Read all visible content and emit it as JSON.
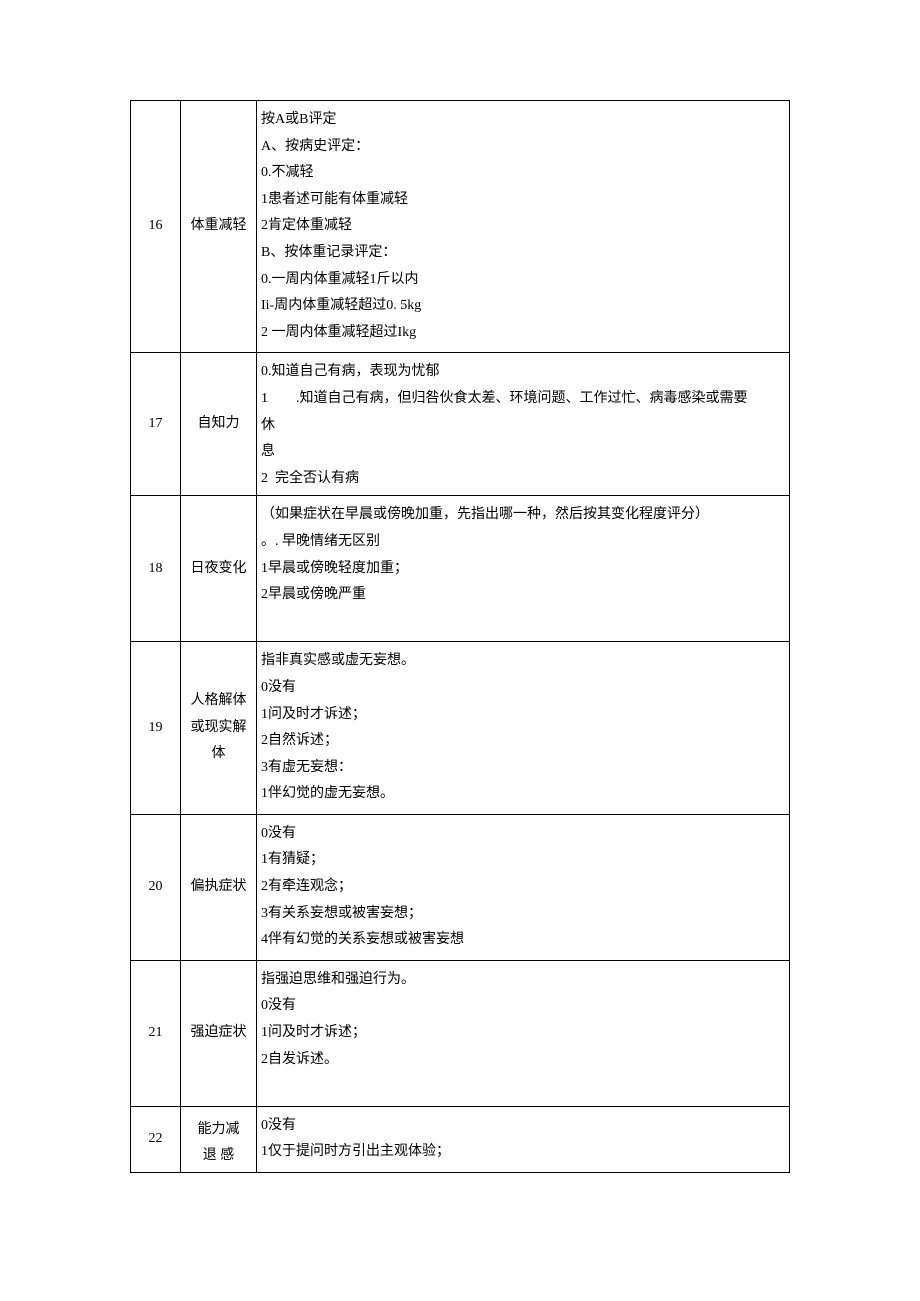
{
  "rows": [
    {
      "num": "16",
      "name": "体重减轻",
      "lines": [
        "按A或B评定",
        "A、按病史评定：",
        "0.不减轻",
        "1患者述可能有体重减轻",
        "2肯定体重减轻",
        "B、按体重记录评定：",
        "0.一周内体重减轻1斤以内",
        "Ii-周内体重减轻超过0. 5kg",
        "2 一周内体重减轻超过Ikg"
      ]
    },
    {
      "num": "17",
      "name": "自知力",
      "clip": true,
      "lines": [
        "0.知道自己有病，表现为忧郁",
        "1        .知道自己有病，但归咎伙食太差、环境问题、工作过忙、病毒感染或需要",
        "休",
        "息",
        "2  完全否认有病"
      ]
    },
    {
      "num": "18",
      "name": "日夜变化",
      "lines": [
        "（如果症状在早晨或傍晚加重，先指出哪一种，然后按其变化程度评分）",
        "。. 早晚情绪无区别",
        "1早晨或傍晚轻度加重；",
        "2早晨或傍晚严重",
        " "
      ]
    },
    {
      "num": "19",
      "name": "人格解体或现实解体",
      "lines": [
        "指非真实感或虚无妄想。",
        "0没有",
        "1问及时才诉述；",
        "2自然诉述；",
        "3有虚无妄想：",
        "1伴幻觉的虚无妄想。"
      ]
    },
    {
      "num": "20",
      "name": "偏执症状",
      "lines": [
        "0没有",
        "1有猜疑；",
        "2有牵连观念；",
        "3有关系妄想或被害妄想；",
        "4伴有幻觉的关系妄想或被害妄想"
      ]
    },
    {
      "num": "21",
      "name": "强迫症状",
      "lines": [
        "指强迫思维和强迫行为。",
        "0没有",
        "1问及时才诉述；",
        "2自发诉述。",
        " "
      ]
    },
    {
      "num": "22",
      "name": "能力减退 感",
      "nameValign": "bottom",
      "lines": [
        "0没有",
        "1仅于提问时方引出主观体验；"
      ]
    }
  ]
}
